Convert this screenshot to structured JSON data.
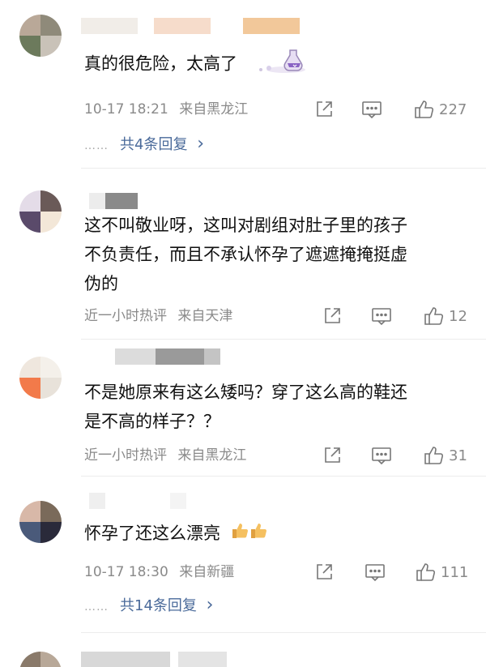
{
  "comments": [
    {
      "text": "真的很危险，太高了",
      "time": "10-17 18:21",
      "source": "来自黑龙江",
      "likes": "227",
      "replies_label": "共4条回复",
      "replies_arrow": "›",
      "dots": "……"
    },
    {
      "text_lines": [
        "这不叫敬业呀，这叫对剧组对肚子里的孩子",
        "不负责任，而且不承认怀孕了遮遮掩掩挺虚",
        "伪的"
      ],
      "time": "近一小时热评",
      "source": "来自天津",
      "likes": "12"
    },
    {
      "text_lines": [
        "不是她原来有这么矮吗？穿了这么高的鞋还",
        "是不高的样子？？"
      ],
      "time": "近一小时热评",
      "source": "来自黑龙江",
      "likes": "31"
    },
    {
      "text": "怀孕了还这么漂亮",
      "time": "10-17 18:30",
      "source": "来自新疆",
      "likes": "111",
      "replies_label": "共14条回复",
      "replies_arrow": "›",
      "dots": "……"
    }
  ],
  "icons": {
    "share": "share-icon",
    "comment": "comment-icon",
    "like": "thumbs-up-icon"
  },
  "colors": {
    "meta": "#8a8a8a",
    "reply_link": "#4a6a9a",
    "text": "#111111"
  }
}
